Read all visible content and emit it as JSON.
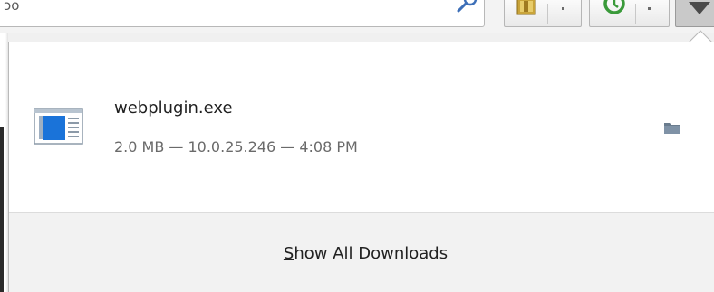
{
  "toolbar": {
    "url_fragment": "ɔo",
    "icons": [
      "search-icon",
      "box-icon",
      "refresh-icon",
      "downloads-icon"
    ]
  },
  "download": {
    "file_name": "webplugin.exe",
    "meta": "2.0 MB — 10.0.25.246 — 4:08 PM",
    "file_icon": "application-file-icon",
    "action_icon": "folder-icon"
  },
  "footer": {
    "show_all_accel": "S",
    "show_all_rest": "how All Downloads"
  },
  "colors": {
    "panel_bg": "#ffffff",
    "footer_bg": "#f2f2f2",
    "file_icon_blue": "#1a73d9"
  }
}
